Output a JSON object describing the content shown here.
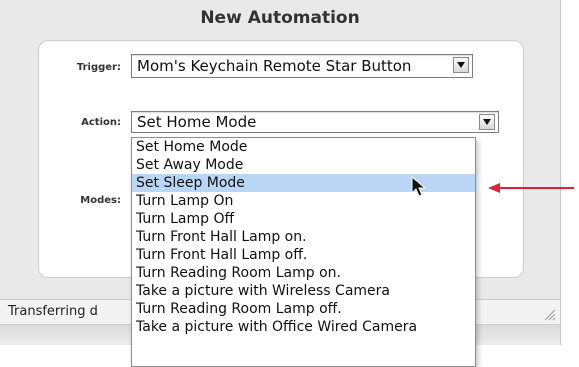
{
  "window": {
    "title": "New Automation"
  },
  "form": {
    "trigger_label": "Trigger:",
    "trigger_value": "Mom's Keychain Remote Star Button",
    "action_label": "Action:",
    "action_value": "Set Home Mode",
    "modes_label": "Modes:"
  },
  "dropdown": {
    "options": [
      "Set Home Mode",
      "Set Away Mode",
      "Set Sleep Mode",
      "Turn Lamp On",
      "Turn Lamp Off",
      "Turn Front Hall Lamp on.",
      "Turn Front Hall Lamp off.",
      "Turn Reading Room Lamp on.",
      "Take a picture with Wireless Camera",
      "Turn Reading Room Lamp off.",
      "Take a picture with Office Wired Camera"
    ],
    "highlighted_option": "Set Sleep Mode"
  },
  "status": {
    "text": "Transferring d"
  },
  "colors": {
    "highlight": "#b9d6f6",
    "annotation_arrow": "#e0203a"
  },
  "icons": {
    "dropdown_arrow": "chevron-down-icon",
    "cursor": "mouse-pointer-icon",
    "annotation": "red-arrow-icon",
    "resize": "resize-grip-icon"
  }
}
